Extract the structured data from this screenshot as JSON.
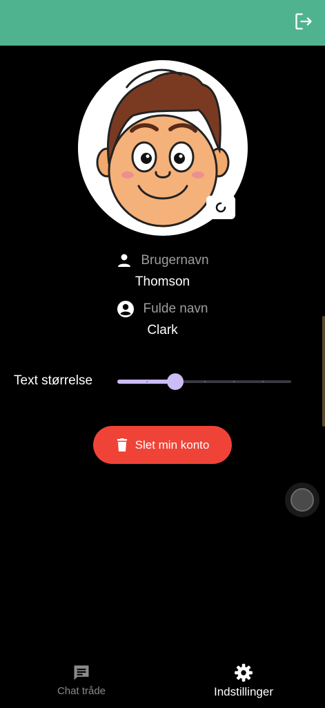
{
  "header": {
    "background": "#4fb38f",
    "logout_icon": "logout-icon"
  },
  "profile": {
    "avatar_icon": "cartoon-avatar",
    "edit_icon": "refresh-icon",
    "username_label": "Brugernavn",
    "username_value": "Thomson",
    "fullname_label": "Fulde navn",
    "fullname_value": "Clark"
  },
  "text_size": {
    "label": "Text størrelse",
    "value": 2,
    "max": 6,
    "accent": "#cbbcf6"
  },
  "delete_account": {
    "label": "Slet min konto",
    "icon": "trash-icon",
    "color": "#f04338"
  },
  "bottom_nav": {
    "items": [
      {
        "label": "Chat tråde",
        "icon": "chat-icon",
        "active": false
      },
      {
        "label": "Indstillinger",
        "icon": "gear-icon",
        "active": true
      }
    ]
  }
}
